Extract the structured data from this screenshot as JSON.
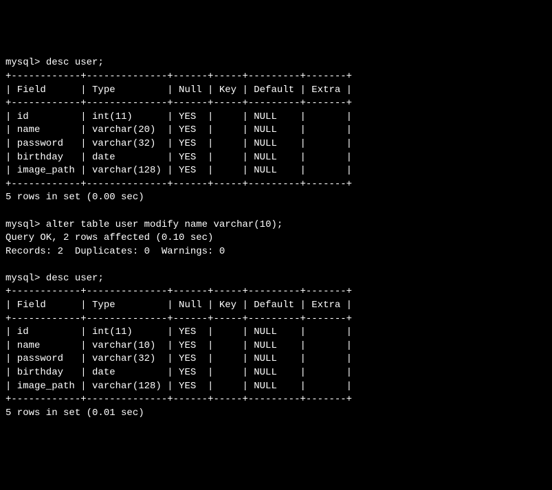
{
  "prompt": "mysql>",
  "commands": {
    "desc1": "desc user;",
    "alter": "alter table user modify name varchar(10);",
    "desc2": "desc user;"
  },
  "table1": {
    "border_top": "+------------+--------------+------+-----+---------+-------+",
    "header": "| Field      | Type         | Null | Key | Default | Extra |",
    "border_mid": "+------------+--------------+------+-----+---------+-------+",
    "rows": [
      "| id         | int(11)      | YES  |     | NULL    |       |",
      "| name       | varchar(20)  | YES  |     | NULL    |       |",
      "| password   | varchar(32)  | YES  |     | NULL    |       |",
      "| birthday   | date         | YES  |     | NULL    |       |",
      "| image_path | varchar(128) | YES  |     | NULL    |       |"
    ],
    "border_bot": "+------------+--------------+------+-----+---------+-------+",
    "summary": "5 rows in set (0.00 sec)"
  },
  "alter_result": {
    "line1": "Query OK, 2 rows affected (0.10 sec)",
    "line2": "Records: 2  Duplicates: 0  Warnings: 0"
  },
  "table2": {
    "border_top": "+------------+--------------+------+-----+---------+-------+",
    "header": "| Field      | Type         | Null | Key | Default | Extra |",
    "border_mid": "+------------+--------------+------+-----+---------+-------+",
    "rows": [
      "| id         | int(11)      | YES  |     | NULL    |       |",
      "| name       | varchar(10)  | YES  |     | NULL    |       |",
      "| password   | varchar(32)  | YES  |     | NULL    |       |",
      "| birthday   | date         | YES  |     | NULL    |       |",
      "| image_path | varchar(128) | YES  |     | NULL    |       |"
    ],
    "border_bot": "+------------+--------------+------+-----+---------+-------+",
    "summary": "5 rows in set (0.01 sec)"
  }
}
